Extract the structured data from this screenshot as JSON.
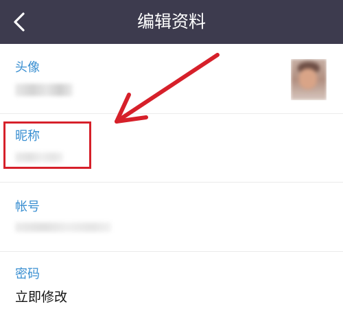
{
  "header": {
    "title": "编辑资料",
    "back_icon": "chevron-left-icon"
  },
  "fields": {
    "avatar": {
      "label": "头像"
    },
    "nickname": {
      "label": "昵称"
    },
    "account": {
      "label": "帐号"
    },
    "password": {
      "label": "密码",
      "value": "立即修改"
    }
  },
  "colors": {
    "header_bg": "#3d3b4e",
    "label": "#3a8fd1",
    "annotation": "#d6202a"
  }
}
